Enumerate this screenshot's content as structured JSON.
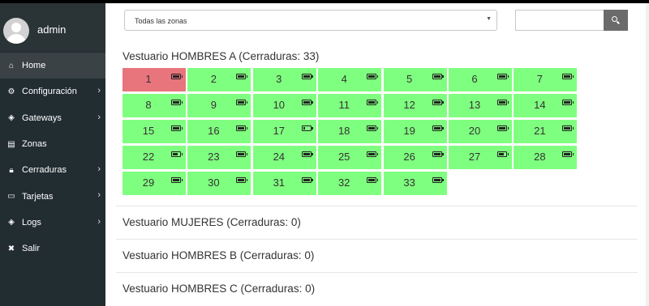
{
  "user": {
    "name": "admin"
  },
  "menu": [
    {
      "label": "Home",
      "icon": "home-icon",
      "glyph": "⌂",
      "active": true,
      "chevron": false
    },
    {
      "label": "Configuración",
      "icon": "gear-icon",
      "glyph": "⚙",
      "active": false,
      "chevron": true
    },
    {
      "label": "Gateways",
      "icon": "gateway-icon",
      "glyph": "◈",
      "active": false,
      "chevron": true
    },
    {
      "label": "Zonas",
      "icon": "building-icon",
      "glyph": "▤",
      "active": false,
      "chevron": false
    },
    {
      "label": "Cerraduras",
      "icon": "lock-icon",
      "glyph": "🔒︎",
      "active": false,
      "chevron": true
    },
    {
      "label": "Tarjetas",
      "icon": "card-icon",
      "glyph": "▭",
      "active": false,
      "chevron": true
    },
    {
      "label": "Logs",
      "icon": "logs-icon",
      "glyph": "◈",
      "active": false,
      "chevron": true
    },
    {
      "label": "Salir",
      "icon": "close-icon",
      "glyph": "✖",
      "active": false,
      "chevron": false
    }
  ],
  "zone_select": {
    "value": "Todas las zonas"
  },
  "search": {
    "placeholder": ""
  },
  "zones": [
    {
      "title": "Vestuario HOMBRES A (Cerraduras: 33)",
      "locks": [
        {
          "n": "1",
          "state": "alert",
          "battery": 1.0
        },
        {
          "n": "2",
          "state": "ok",
          "battery": 1.0
        },
        {
          "n": "3",
          "state": "ok",
          "battery": 1.0
        },
        {
          "n": "4",
          "state": "ok",
          "battery": 1.0
        },
        {
          "n": "5",
          "state": "ok",
          "battery": 1.0
        },
        {
          "n": "6",
          "state": "ok",
          "battery": 1.0
        },
        {
          "n": "7",
          "state": "ok",
          "battery": 1.0
        },
        {
          "n": "8",
          "state": "ok",
          "battery": 1.0
        },
        {
          "n": "9",
          "state": "ok",
          "battery": 1.0
        },
        {
          "n": "10",
          "state": "ok",
          "battery": 1.0
        },
        {
          "n": "11",
          "state": "ok",
          "battery": 1.0
        },
        {
          "n": "12",
          "state": "ok",
          "battery": 1.0
        },
        {
          "n": "13",
          "state": "ok",
          "battery": 1.0
        },
        {
          "n": "14",
          "state": "ok",
          "battery": 1.0
        },
        {
          "n": "15",
          "state": "ok",
          "battery": 1.0
        },
        {
          "n": "16",
          "state": "ok",
          "battery": 1.0
        },
        {
          "n": "17",
          "state": "ok",
          "battery": 0.3
        },
        {
          "n": "18",
          "state": "ok",
          "battery": 1.0
        },
        {
          "n": "19",
          "state": "ok",
          "battery": 1.0
        },
        {
          "n": "20",
          "state": "ok",
          "battery": 1.0
        },
        {
          "n": "21",
          "state": "ok",
          "battery": 1.0
        },
        {
          "n": "22",
          "state": "ok",
          "battery": 0.7
        },
        {
          "n": "23",
          "state": "ok",
          "battery": 1.0
        },
        {
          "n": "24",
          "state": "ok",
          "battery": 1.0
        },
        {
          "n": "25",
          "state": "ok",
          "battery": 1.0
        },
        {
          "n": "26",
          "state": "ok",
          "battery": 1.0
        },
        {
          "n": "27",
          "state": "ok",
          "battery": 0.7
        },
        {
          "n": "28",
          "state": "ok",
          "battery": 1.0
        },
        {
          "n": "29",
          "state": "ok",
          "battery": 1.0
        },
        {
          "n": "30",
          "state": "ok",
          "battery": 1.0
        },
        {
          "n": "31",
          "state": "ok",
          "battery": 1.0
        },
        {
          "n": "32",
          "state": "ok",
          "battery": 1.0
        },
        {
          "n": "33",
          "state": "ok",
          "battery": 1.0
        }
      ]
    },
    {
      "title": "Vestuario MUJERES (Cerraduras: 0)",
      "locks": []
    },
    {
      "title": "Vestuario HOMBRES B (Cerraduras: 0)",
      "locks": []
    },
    {
      "title": "Vestuario HOMBRES C (Cerraduras: 0)",
      "locks": []
    }
  ],
  "colors": {
    "sidebar": "#222d32",
    "lock_ok": "#7fff7f",
    "lock_alert": "#e8747c",
    "search_button": "#6b6b6b"
  }
}
